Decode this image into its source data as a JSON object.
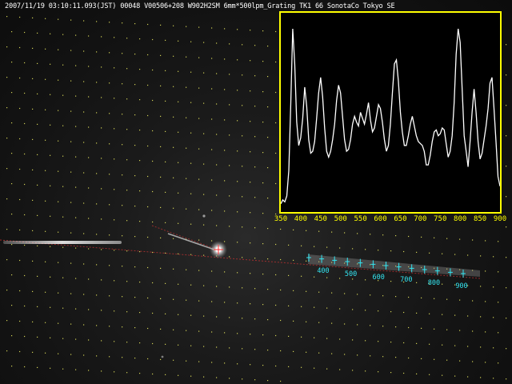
{
  "header": {
    "caption": "2007/11/19 03:10:11.093(JST) 00048 V00506+208 W902H2SM 6mm*500lpm_Grating TK1 66 SonotaCo Tokyo SE"
  },
  "colors": {
    "inset_border": "#ffff00",
    "inset_background": "#000000",
    "spectrum_line": "#ffffff",
    "tick_labels": "#ffff00",
    "wavelength_markers": "#33e6f2",
    "star_grid_dots": "#ffff66",
    "meteor_trail_guide": "#b03030"
  },
  "chart_data": {
    "type": "line",
    "title": "",
    "xlabel": "",
    "ylabel": "",
    "xlim": [
      350,
      900
    ],
    "ylim": [
      0,
      1
    ],
    "x_ticks": [
      350,
      400,
      450,
      500,
      550,
      600,
      650,
      700,
      750,
      800,
      850,
      900
    ],
    "grid": false,
    "legend": "none",
    "series": [
      {
        "x": [
          350,
          355,
          360,
          365,
          370,
          375,
          380,
          385,
          390,
          395,
          400,
          405,
          410,
          415,
          420,
          425,
          430,
          435,
          440,
          445,
          450,
          455,
          460,
          465,
          470,
          475,
          480,
          485,
          490,
          495,
          500,
          505,
          510,
          515,
          520,
          525,
          530,
          535,
          540,
          545,
          550,
          555,
          560,
          565,
          570,
          575,
          580,
          585,
          590,
          595,
          600,
          605,
          610,
          615,
          620,
          625,
          630,
          635,
          640,
          645,
          650,
          655,
          660,
          665,
          670,
          675,
          680,
          685,
          690,
          695,
          700,
          705,
          710,
          715,
          720,
          725,
          730,
          735,
          740,
          745,
          750,
          755,
          760,
          765,
          770,
          775,
          780,
          785,
          790,
          795,
          800,
          805,
          810,
          815,
          820,
          825,
          830,
          835,
          840,
          845,
          850,
          855,
          860,
          865,
          870,
          875,
          880,
          885,
          890,
          895,
          900
        ],
        "values": [
          0.03,
          0.05,
          0.04,
          0.07,
          0.2,
          0.55,
          0.93,
          0.75,
          0.45,
          0.33,
          0.37,
          0.47,
          0.63,
          0.53,
          0.36,
          0.29,
          0.3,
          0.35,
          0.47,
          0.6,
          0.68,
          0.58,
          0.42,
          0.3,
          0.27,
          0.3,
          0.36,
          0.44,
          0.56,
          0.64,
          0.6,
          0.48,
          0.36,
          0.3,
          0.31,
          0.36,
          0.44,
          0.48,
          0.45,
          0.43,
          0.5,
          0.47,
          0.44,
          0.49,
          0.55,
          0.46,
          0.4,
          0.42,
          0.48,
          0.54,
          0.52,
          0.45,
          0.36,
          0.3,
          0.33,
          0.44,
          0.6,
          0.75,
          0.77,
          0.66,
          0.5,
          0.4,
          0.33,
          0.33,
          0.38,
          0.44,
          0.48,
          0.43,
          0.38,
          0.35,
          0.34,
          0.33,
          0.3,
          0.23,
          0.23,
          0.28,
          0.35,
          0.4,
          0.41,
          0.38,
          0.39,
          0.42,
          0.41,
          0.34,
          0.27,
          0.3,
          0.38,
          0.55,
          0.8,
          0.93,
          0.86,
          0.62,
          0.38,
          0.3,
          0.22,
          0.35,
          0.5,
          0.62,
          0.5,
          0.35,
          0.26,
          0.29,
          0.36,
          0.43,
          0.52,
          0.65,
          0.68,
          0.52,
          0.35,
          0.17,
          0.12
        ]
      }
    ]
  },
  "wavelength_markers": {
    "labels": [
      "400",
      "500",
      "600",
      "700",
      "800",
      "900"
    ]
  }
}
